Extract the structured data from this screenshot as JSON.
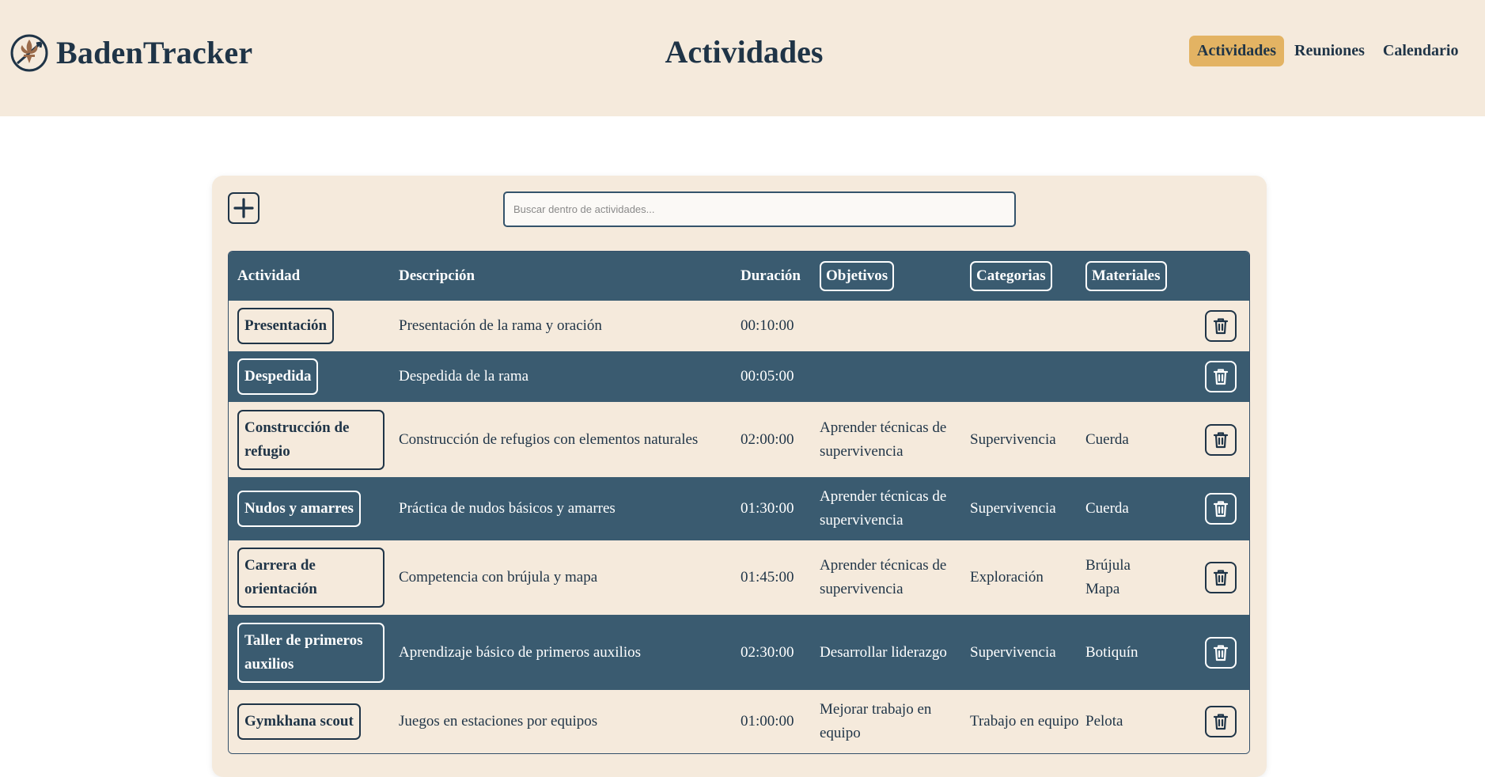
{
  "header": {
    "brand": "BadenTracker",
    "title": "Actividades",
    "nav": [
      {
        "label": "Actividades",
        "active": true
      },
      {
        "label": "Reuniones",
        "active": false
      },
      {
        "label": "Calendario",
        "active": false
      }
    ]
  },
  "search": {
    "placeholder": "Buscar dentro de actividades..."
  },
  "table": {
    "headers": {
      "actividad": "Actividad",
      "descripcion": "Descripción",
      "duracion": "Duración",
      "objetivos": "Objetivos",
      "categorias": "Categorias",
      "materiales": "Materiales"
    },
    "rows": [
      {
        "actividad": "Presentación",
        "descripcion": "Presentación de la rama y oración",
        "duracion": "00:10:00",
        "objetivos": "",
        "categorias": "",
        "materiales": ""
      },
      {
        "actividad": "Despedida",
        "descripcion": "Despedida de la rama",
        "duracion": "00:05:00",
        "objetivos": "",
        "categorias": "",
        "materiales": ""
      },
      {
        "actividad": "Construcción de refugio",
        "descripcion": "Construcción de refugios con elementos naturales",
        "duracion": "02:00:00",
        "objetivos": "Aprender técnicas de supervivencia",
        "categorias": "Supervivencia",
        "materiales": "Cuerda"
      },
      {
        "actividad": "Nudos y amarres",
        "descripcion": "Práctica de nudos básicos y amarres",
        "duracion": "01:30:00",
        "objetivos": "Aprender técnicas de supervivencia",
        "categorias": "Supervivencia",
        "materiales": "Cuerda"
      },
      {
        "actividad": "Carrera de orientación",
        "descripcion": "Competencia con brújula y mapa",
        "duracion": "01:45:00",
        "objetivos": "Aprender técnicas de supervivencia",
        "categorias": "Exploración",
        "materiales": "Brújula Mapa"
      },
      {
        "actividad": "Taller de primeros auxilios",
        "descripcion": "Aprendizaje básico de primeros auxilios",
        "duracion": "02:30:00",
        "objetivos": "Desarrollar liderazgo",
        "categorias": "Supervivencia",
        "materiales": "Botiquín"
      },
      {
        "actividad": "Gymkhana scout",
        "descripcion": "Juegos en estaciones por equipos",
        "duracion": "01:00:00",
        "objetivos": "Mejorar trabajo en equipo",
        "categorias": "Trabajo en equipo",
        "materiales": "Pelota"
      }
    ]
  },
  "colors": {
    "header_bg": "#f5eadc",
    "primary": "#1f3447",
    "table_dark": "#3a5b70",
    "accent": "#e3b363"
  }
}
